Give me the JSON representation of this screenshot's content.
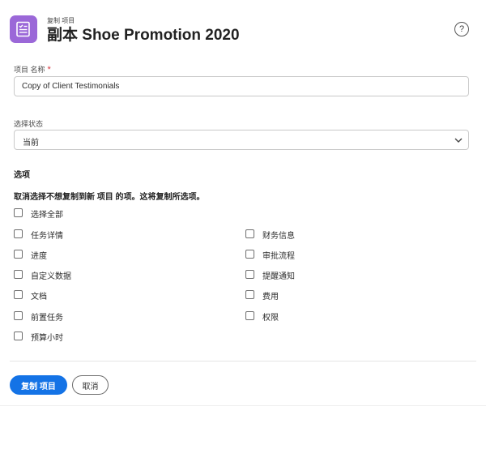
{
  "header": {
    "eyebrow": "复制 项目",
    "title": "副本 Shoe Promotion 2020",
    "app_icon": "checklist-icon",
    "help_icon_glyph": "?",
    "icon_color": "#9b68d8"
  },
  "project_name": {
    "label": "项目 名称",
    "required_mark": "*",
    "value": "Copy of Client Testimonials"
  },
  "status": {
    "label": "选择状态",
    "value": "当前"
  },
  "options": {
    "title": "选项",
    "instruction": "取消选择不想复制到新 项目 的项。这将复制所选项。",
    "select_all": "选择全部",
    "left_column": [
      "任务详情",
      "进度",
      "自定义数据",
      "文档",
      "前置任务",
      "预算小时"
    ],
    "right_column": [
      "财务信息",
      "审批流程",
      "提醒通知",
      "费用",
      "权限"
    ]
  },
  "actions": {
    "primary_label": "复制 项目",
    "cancel_label": "取消",
    "primary_color": "#1473e6"
  }
}
